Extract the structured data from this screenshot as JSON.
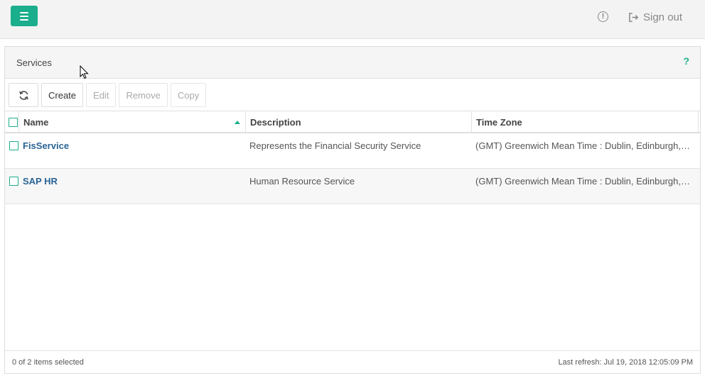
{
  "topbar": {
    "menu_icon": "hamburger-icon",
    "info_icon": "info-icon",
    "signout_icon": "sign-out-icon",
    "signout_label": "Sign out",
    "accent_color": "#1aae8c"
  },
  "panel": {
    "title": "Services",
    "help_label": "?"
  },
  "toolbar": {
    "refresh_icon": "refresh-icon",
    "create_label": "Create",
    "edit_label": "Edit",
    "remove_label": "Remove",
    "copy_label": "Copy"
  },
  "grid": {
    "columns": [
      {
        "label": "Name",
        "sorted": "ascending"
      },
      {
        "label": "Description"
      },
      {
        "label": "Time Zone"
      }
    ],
    "rows": [
      {
        "name": "FisService",
        "description": "Represents the Financial Security Service",
        "timezone": "(GMT) Greenwich Mean Time : Dublin, Edinburgh, Lisbon, London"
      },
      {
        "name": "SAP HR",
        "description": "Human Resource Service",
        "timezone": "(GMT) Greenwich Mean Time : Dublin, Edinburgh, Lisbon, London"
      }
    ]
  },
  "footer": {
    "selection_text": "0 of 2 items selected",
    "last_refresh": "Last refresh: Jul 19, 2018 12:05:09 PM"
  }
}
